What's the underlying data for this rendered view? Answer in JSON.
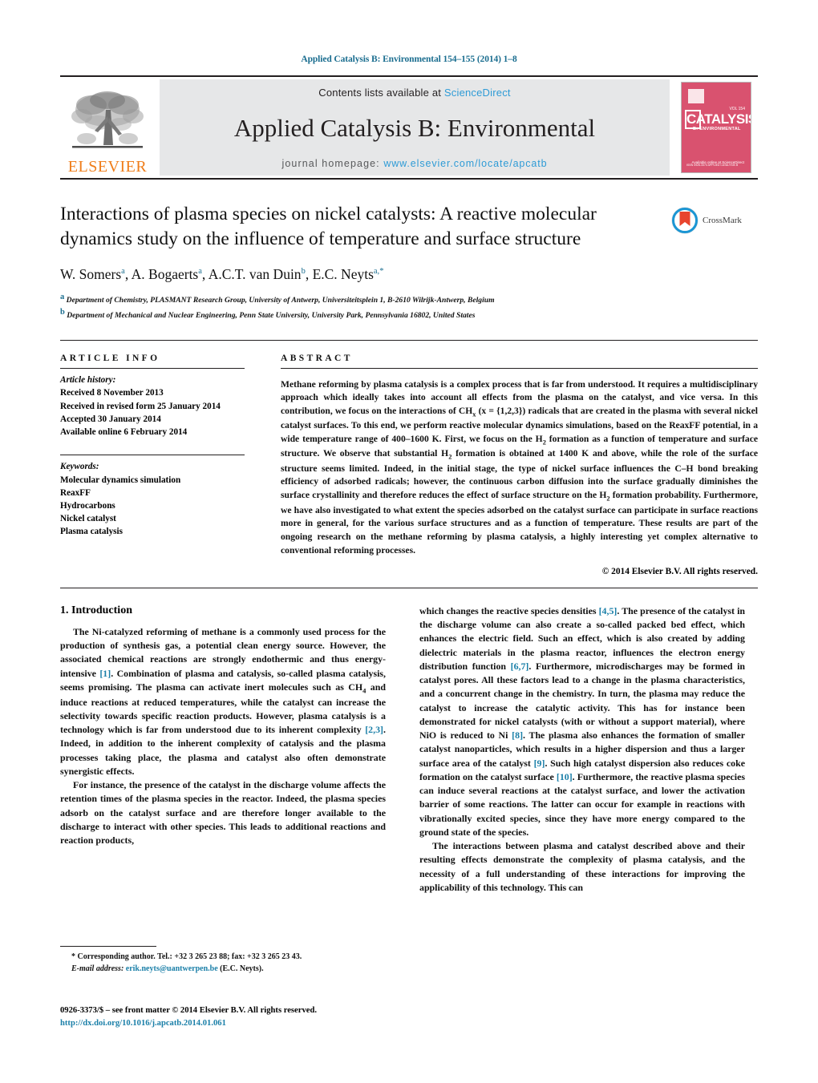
{
  "running_head": "Applied Catalysis B: Environmental 154–155 (2014) 1–8",
  "masthead": {
    "publisher_name": "ELSEVIER",
    "contents_prefix": "Contents lists available at ",
    "contents_link": "ScienceDirect",
    "journal_title": "Applied Catalysis B: Environmental",
    "homepage_prefix": "journal homepage: ",
    "homepage_url": "www.elsevier.com/locate/apcatb",
    "cover": {
      "main_word": "CATALYSIS",
      "sub_word": "B: ENVIRONMENTAL",
      "corner_tag": "VOL 154",
      "bottom_note": "Available online at\nScienceDirect",
      "bottom_left_note": "ISSN 0926-3373\nAPPLIED CATALYSIS B"
    }
  },
  "article": {
    "title": "Interactions of plasma species on nickel catalysts: A reactive molecular dynamics study on the influence of temperature and surface structure",
    "crossmark_label": "CrossMark",
    "authors": [
      {
        "name": "W. Somers",
        "sup": "a",
        "sep": ", "
      },
      {
        "name": "A. Bogaerts",
        "sup": "a",
        "sep": ", "
      },
      {
        "name": "A.C.T. van Duin",
        "sup": "b",
        "sep": ", "
      },
      {
        "name": "E.C. Neyts",
        "sup": "a,",
        "star": "*",
        "sep": ""
      }
    ],
    "affiliations": [
      {
        "marker": "a",
        "text": "Department of Chemistry, PLASMANT Research Group, University of Antwerp, Universiteitsplein 1, B-2610 Wilrijk-Antwerp, Belgium"
      },
      {
        "marker": "b",
        "text": "Department of Mechanical and Nuclear Engineering, Penn State University, University Park, Pennsylvania 16802, United States"
      }
    ]
  },
  "article_info": {
    "heading": "ARTICLE INFO",
    "history_label": "Article history:",
    "history": [
      "Received 8 November 2013",
      "Received in revised form 25 January 2014",
      "Accepted 30 January 2014",
      "Available online 6 February 2014"
    ],
    "keywords_label": "Keywords:",
    "keywords": [
      "Molecular dynamics simulation",
      "ReaxFF",
      "Hydrocarbons",
      "Nickel catalyst",
      "Plasma catalysis"
    ]
  },
  "abstract": {
    "heading": "ABSTRACT",
    "paragraph_1": "Methane reforming by plasma catalysis is a complex process that is far from understood. It requires a multidisciplinary approach which ideally takes into account all effects from the plasma on the catalyst, and vice versa. In this contribution, we focus on the interactions of CH",
    "formula_sub_1": "x",
    "paragraph_2": " (x = {1,2,3}) radicals that are created in the plasma with several nickel catalyst surfaces. To this end, we perform reactive molecular dynamics simulations, based on the ReaxFF potential, in a wide temperature range of 400–1600 K. First, we focus on the H",
    "formula_sub_2": "2",
    "paragraph_3": " formation as a function of temperature and surface structure. We observe that substantial H",
    "formula_sub_3": "2",
    "paragraph_4": " formation is obtained at 1400 K and above, while the role of the surface structure seems limited. Indeed, in the initial stage, the type of nickel surface influences the C–H bond breaking efficiency of adsorbed radicals; however, the continuous carbon diffusion into the surface gradually diminishes the surface crystallinity and therefore reduces the effect of surface structure on the H",
    "formula_sub_4": "2",
    "paragraph_5": " formation probability. Furthermore, we have also investigated to what extent the species adsorbed on the catalyst surface can participate in surface reactions more in general, for the various surface structures and as a function of temperature. These results are part of the ongoing research on the methane reforming by plasma catalysis, a highly interesting yet complex alternative to conventional reforming processes.",
    "copyright": "© 2014 Elsevier B.V. All rights reserved."
  },
  "intro": {
    "section_number_title": "1.  Introduction",
    "left_p1_a": "The Ni-catalyzed reforming of methane is a commonly used process for the production of synthesis gas, a potential clean energy source. However, the associated chemical reactions are strongly endothermic and thus energy-intensive ",
    "left_p1_ref1": "[1]",
    "left_p1_b": ". Combination of plasma and catalysis, so-called plasma catalysis, seems promising. The plasma can activate inert molecules such as CH",
    "left_p1_sub": "4",
    "left_p1_c": " and induce reactions at reduced temperatures, while the catalyst can increase the selectivity towards specific reaction products. However, plasma catalysis is a technology which is far from understood due to its inherent complexity ",
    "left_p1_ref2": "[2,3]",
    "left_p1_d": ". Indeed, in addition to the inherent complexity of catalysis and the plasma processes taking place, the plasma and catalyst also often demonstrate synergistic effects.",
    "left_p2": "For instance, the presence of the catalyst in the discharge volume affects the retention times of the plasma species in the reactor. Indeed, the plasma species adsorb on the catalyst surface and are therefore longer available to the discharge to interact with other species. This leads to additional reactions and reaction products,",
    "right_p1_a": "which changes the reactive species densities ",
    "right_p1_ref1": "[4,5]",
    "right_p1_b": ". The presence of the catalyst in the discharge volume can also create a so-called packed bed effect, which enhances the electric field. Such an effect, which is also created by adding dielectric materials in the plasma reactor, influences the electron energy distribution function ",
    "right_p1_ref2": "[6,7]",
    "right_p1_c": ". Furthermore, microdischarges may be formed in catalyst pores. All these factors lead to a change in the plasma characteristics, and a concurrent change in the chemistry. In turn, the plasma may reduce the catalyst to increase the catalytic activity. This has for instance been demonstrated for nickel catalysts (with or without a support material), where NiO is reduced to Ni ",
    "right_p1_ref3": "[8]",
    "right_p1_d": ". The plasma also enhances the formation of smaller catalyst nanoparticles, which results in a higher dispersion and thus a larger surface area of the catalyst ",
    "right_p1_ref4": "[9]",
    "right_p1_e": ". Such high catalyst dispersion also reduces coke formation on the catalyst surface ",
    "right_p1_ref5": "[10]",
    "right_p1_f": ". Furthermore, the reactive plasma species can induce several reactions at the catalyst surface, and lower the activation barrier of some reactions. The latter can occur for example in reactions with vibrationally excited species, since they have more energy compared to the ground state of the species.",
    "right_p2": "The interactions between plasma and catalyst described above and their resulting effects demonstrate the complexity of plasma catalysis, and the necessity of a full understanding of these interactions for improving the applicability of this technology. This can"
  },
  "footer": {
    "corresponding_marker": "*",
    "corresponding_text": "Corresponding author. Tel.: +32 3 265 23 88; fax: +32 3 265 23 43.",
    "email_label": "E-mail address:",
    "email": "erik.neyts@uantwerpen.be",
    "email_owner": "(E.C. Neyts).",
    "issn_line": "0926-3373/$ – see front matter © 2014 Elsevier B.V. All rights reserved.",
    "doi_line": "http://dx.doi.org/10.1016/j.apcatb.2014.01.061"
  },
  "colors": {
    "link_blue": "#1a7fa8",
    "sciencedirect_blue": "#2e9bd6",
    "elsevier_orange": "#ef7d1a",
    "cover_pink": "#d9526f",
    "band_gray": "#e6e7e8"
  }
}
